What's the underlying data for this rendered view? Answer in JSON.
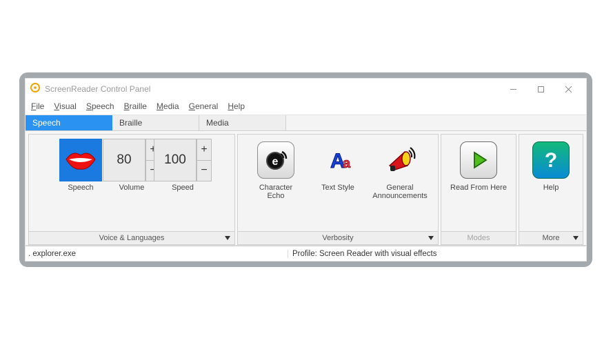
{
  "title": "ScreenReader Control Panel",
  "menu": [
    "File",
    "Visual",
    "Speech",
    "Braille",
    "Media",
    "General",
    "Help"
  ],
  "tabs": {
    "active": "Speech",
    "items": [
      "Speech",
      "Braille",
      "Media"
    ]
  },
  "groups": {
    "voice": {
      "footer_label": "Voice & Languages",
      "speech_label": "Speech",
      "volume_label": "Volume",
      "speed_label": "Speed",
      "volume_value": "80",
      "speed_value": "100"
    },
    "verbosity": {
      "footer_label": "Verbosity",
      "char_echo_label": "Character\nEcho",
      "text_style_label": "Text Style",
      "announce_label": "General\nAnnouncements"
    },
    "modes": {
      "footer_label": "Modes",
      "read_label": "Read From Here"
    },
    "more": {
      "footer_label": "More",
      "help_label": "Help"
    }
  },
  "status": {
    "left": ". explorer.exe",
    "right": "Profile: Screen Reader with visual effects"
  },
  "icons": {
    "app": "app-icon",
    "min": "minimize-icon",
    "max": "maximize-icon",
    "close": "close-icon",
    "lips": "lips-icon",
    "echo": "echo-icon",
    "aa": "text-style-icon",
    "horn": "megaphone-icon",
    "play": "play-icon",
    "help": "question-icon",
    "chevron": "chevron-down-icon"
  }
}
